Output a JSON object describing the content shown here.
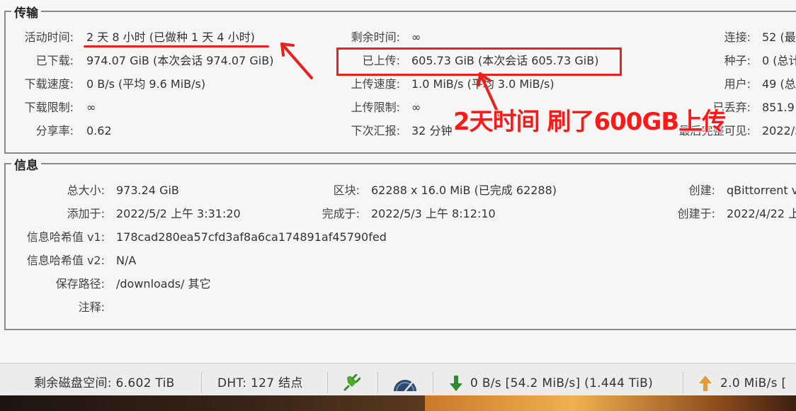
{
  "transfer": {
    "legend": "传输",
    "active_time": {
      "label": "活动时间:",
      "value": "2 天 8 小时 (已做种 1 天 4 小时)"
    },
    "downloaded": {
      "label": "已下载:",
      "value": "974.07 GiB (本次会话 974.07 GiB)"
    },
    "dl_speed": {
      "label": "下载速度:",
      "value": "0 B/s (平均 9.6 MiB/s)"
    },
    "dl_limit": {
      "label": "下载限制:",
      "value": "∞"
    },
    "share_ratio": {
      "label": "分享率:",
      "value": "0.62"
    },
    "eta": {
      "label": "剩余时间:",
      "value": "∞"
    },
    "uploaded": {
      "label": "已上传:",
      "value": "605.73 GiB (本次会话 605.73 GiB)"
    },
    "ul_speed": {
      "label": "上传速度:",
      "value": "1.0 MiB/s (平均 3.0 MiB/s)"
    },
    "ul_limit": {
      "label": "上传限制:",
      "value": "∞"
    },
    "reannounce": {
      "label": "下次汇报:",
      "value": "32 分钟"
    },
    "connections": {
      "label": "连接:",
      "value": "52 (最"
    },
    "seeds": {
      "label": "种子:",
      "value": "0 (总计"
    },
    "peers": {
      "label": "用户:",
      "value": "49 (总"
    },
    "wasted": {
      "label": "已丢弃:",
      "value": "851.9"
    },
    "last_complete": {
      "label": "最后完整可见:",
      "value": "2022/5"
    }
  },
  "info": {
    "legend": "信息",
    "total_size": {
      "label": "总大小:",
      "value": "973.24 GiB"
    },
    "added_on": {
      "label": "添加于:",
      "value": "2022/5/2 上午 3:31:20"
    },
    "hash_v1": {
      "label": "信息哈希值 v1:",
      "value": "178cad280ea57cfd3af8a6ca174891af45790fed"
    },
    "hash_v2": {
      "label": "信息哈希值 v2:",
      "value": "N/A"
    },
    "save_path": {
      "label": "保存路径:",
      "value": "/downloads/ 其它"
    },
    "comment": {
      "label": "注释:",
      "value": ""
    },
    "pieces": {
      "label": "区块:",
      "value": "62288 x 16.0 MiB (已完成 62288)"
    },
    "completed_on": {
      "label": "完成于:",
      "value": "2022/5/3 上午 8:12:10"
    },
    "created_by": {
      "label": "创建:",
      "value": "qBittorrent v"
    },
    "created_on": {
      "label": "创建于:",
      "value": "2022/4/22 上"
    }
  },
  "statusbar": {
    "free_space": "剩余磁盘空间:  6.602 TiB",
    "dht": "DHT:  127 结点",
    "download": "0 B/s [54.2 MiB/s] (1.444 TiB)",
    "upload": "2.0 MiB/s ["
  },
  "annotation": {
    "text": "2天时间 刷了600GB上传",
    "color": "#e8211d"
  },
  "icons": {
    "connection": "plug-icon",
    "speed_limit": "speedometer-icon",
    "download": "arrow-down-icon",
    "upload": "arrow-up-icon"
  }
}
